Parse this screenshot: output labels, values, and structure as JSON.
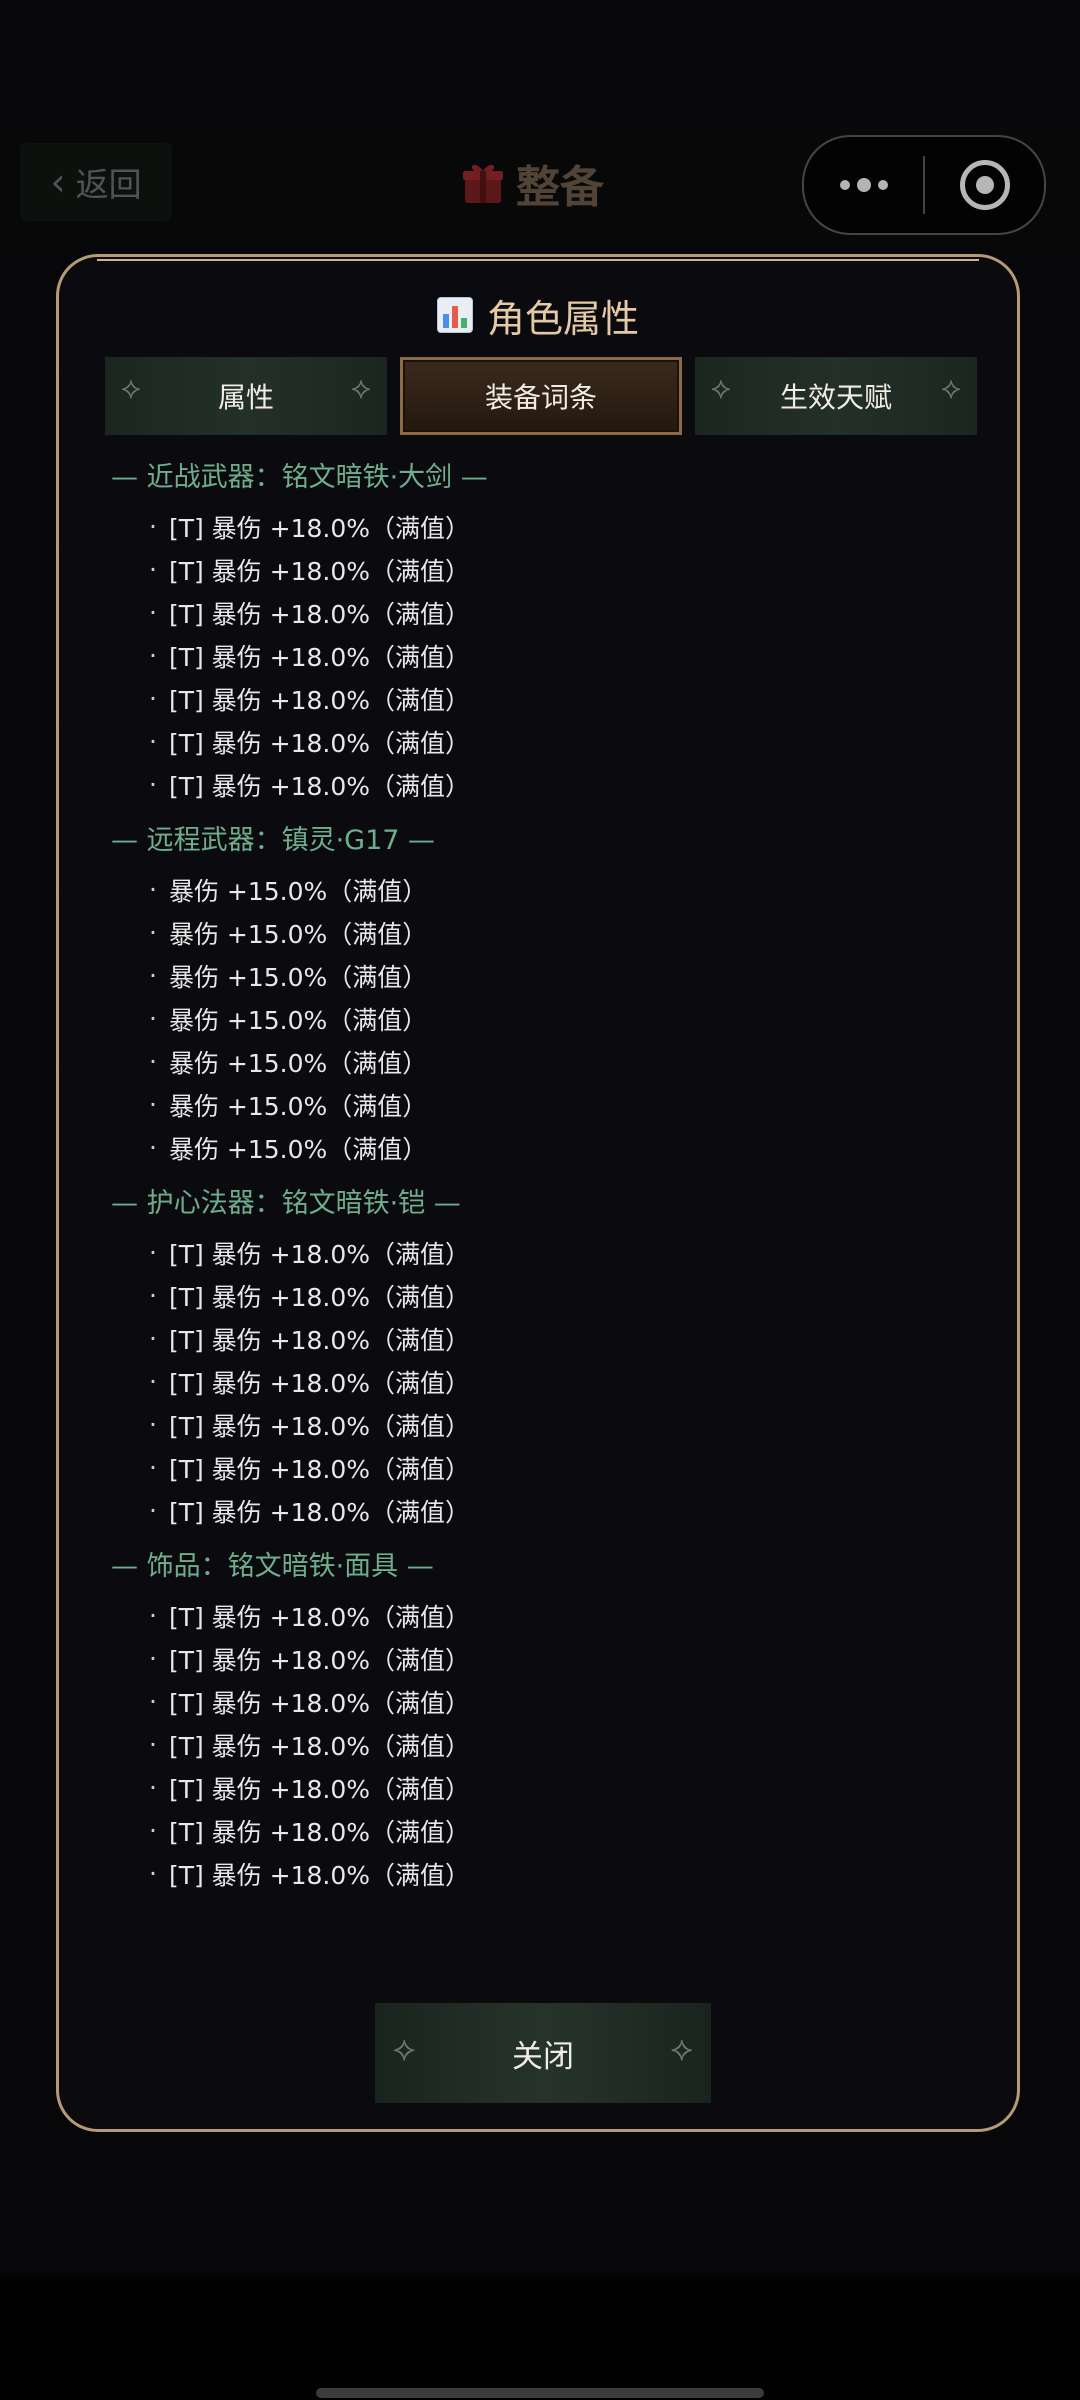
{
  "header": {
    "back_label": "返回",
    "title": "整备"
  },
  "modal": {
    "title": "角色属性",
    "tabs": [
      {
        "label": "属性",
        "active": false
      },
      {
        "label": "装备词条",
        "active": true
      },
      {
        "label": "生效天赋",
        "active": false
      }
    ],
    "groups": [
      {
        "heading": "— 近战武器：铭文暗铁·大剑 —",
        "entries": [
          "[T] 暴伤 +18.0%（满值）",
          "[T] 暴伤 +18.0%（满值）",
          "[T] 暴伤 +18.0%（满值）",
          "[T] 暴伤 +18.0%（满值）",
          "[T] 暴伤 +18.0%（满值）",
          "[T] 暴伤 +18.0%（满值）",
          "[T] 暴伤 +18.0%（满值）"
        ]
      },
      {
        "heading": "— 远程武器：镇灵·G17 —",
        "entries": [
          "暴伤 +15.0%（满值）",
          "暴伤 +15.0%（满值）",
          "暴伤 +15.0%（满值）",
          "暴伤 +15.0%（满值）",
          "暴伤 +15.0%（满值）",
          "暴伤 +15.0%（满值）",
          "暴伤 +15.0%（满值）"
        ]
      },
      {
        "heading": "— 护心法器：铭文暗铁·铠 —",
        "entries": [
          "[T] 暴伤 +18.0%（满值）",
          "[T] 暴伤 +18.0%（满值）",
          "[T] 暴伤 +18.0%（满值）",
          "[T] 暴伤 +18.0%（满值）",
          "[T] 暴伤 +18.0%（满值）",
          "[T] 暴伤 +18.0%（满值）",
          "[T] 暴伤 +18.0%（满值）"
        ]
      },
      {
        "heading": "— 饰品：铭文暗铁·面具 —",
        "entries": [
          "[T] 暴伤 +18.0%（满值）",
          "[T] 暴伤 +18.0%（满值）",
          "[T] 暴伤 +18.0%（满值）",
          "[T] 暴伤 +18.0%（满值）",
          "[T] 暴伤 +18.0%（满值）",
          "[T] 暴伤 +18.0%（满值）",
          "[T] 暴伤 +18.0%（满值）"
        ]
      }
    ],
    "close_label": "关闭"
  },
  "colors": {
    "accent_border": "#b59a76",
    "group_heading": "#6fae8d",
    "title": "#e4c9a6"
  }
}
